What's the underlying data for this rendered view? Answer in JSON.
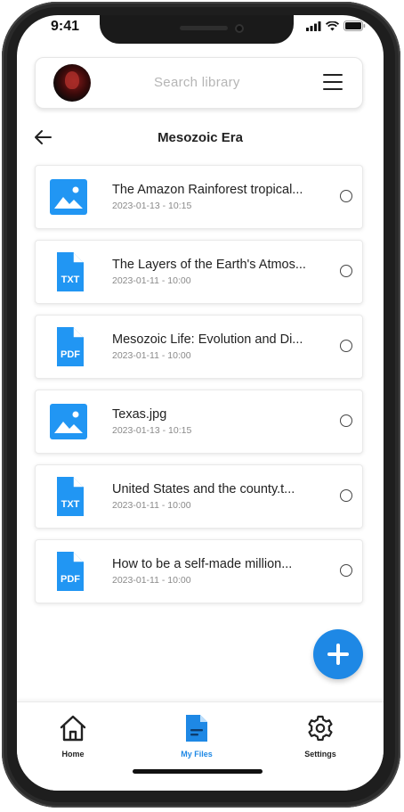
{
  "status_bar": {
    "time": "9:41"
  },
  "header": {
    "search_placeholder": "Search library"
  },
  "page": {
    "title": "Mesozoic Era"
  },
  "files": [
    {
      "name": "The Amazon Rainforest tropical...",
      "date": "2023-01-13 - 10:15",
      "type": "image"
    },
    {
      "name": "The Layers of the Earth's Atmos...",
      "date": "2023-01-11 - 10:00",
      "type": "TXT"
    },
    {
      "name": "Mesozoic Life: Evolution and Di...",
      "date": "2023-01-11 - 10:00",
      "type": "PDF"
    },
    {
      "name": "Texas.jpg",
      "date": "2023-01-13 - 10:15",
      "type": "image"
    },
    {
      "name": "United States and the county.t...",
      "date": "2023-01-11 - 10:00",
      "type": "TXT"
    },
    {
      "name": "How to be a self-made million...",
      "date": "2023-01-11 - 10:00",
      "type": "PDF"
    }
  ],
  "bottom_nav": [
    {
      "label": "Home",
      "icon": "home-icon",
      "active": false
    },
    {
      "label": "My Files",
      "icon": "file-icon",
      "active": true
    },
    {
      "label": "Settings",
      "icon": "gear-icon",
      "active": false
    }
  ],
  "colors": {
    "accent": "#1e88e5",
    "file_icon": "#2196f3"
  }
}
